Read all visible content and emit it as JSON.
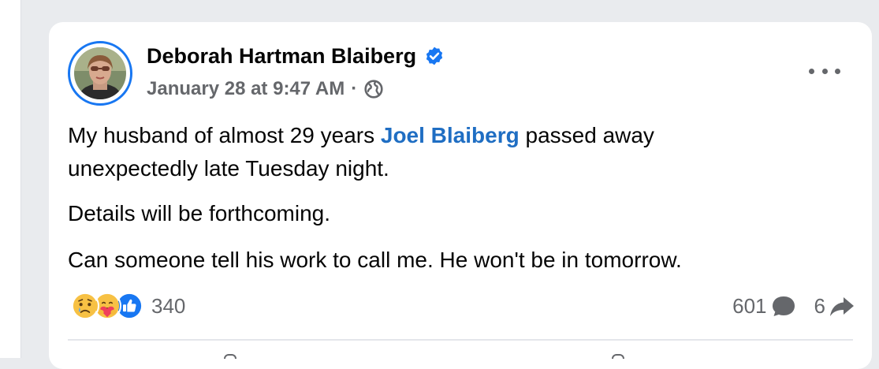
{
  "post": {
    "author": {
      "name": "Deborah Hartman Blaiberg",
      "verified": true
    },
    "timestamp": "January 28 at 9:47 AM",
    "separator": "·",
    "audience_icon": "globe-icon",
    "menu_icon": "more-options-icon",
    "body": {
      "p1_before": "My husband of almost 29 years ",
      "mention": "Joel Blaiberg",
      "p1_after": " passed away",
      "p1_line2": "unexpectedly late Tuesday night.",
      "p2": "Details will be forthcoming.",
      "p3": "Can someone tell his work to call me. He won't be in tomorrow."
    },
    "reactions": {
      "icons": [
        "sad-reaction-icon",
        "care-reaction-icon",
        "like-reaction-icon"
      ],
      "count": "340"
    },
    "stats": {
      "comments": "601",
      "comment_icon": "comment-icon",
      "shares": "6",
      "share_icon": "share-icon"
    }
  },
  "colors": {
    "background": "#e9ebee",
    "card": "#ffffff",
    "accent": "#1877f2",
    "mention": "#1f6ec3",
    "secondary_text": "#65676b",
    "primary_text": "#050505"
  }
}
